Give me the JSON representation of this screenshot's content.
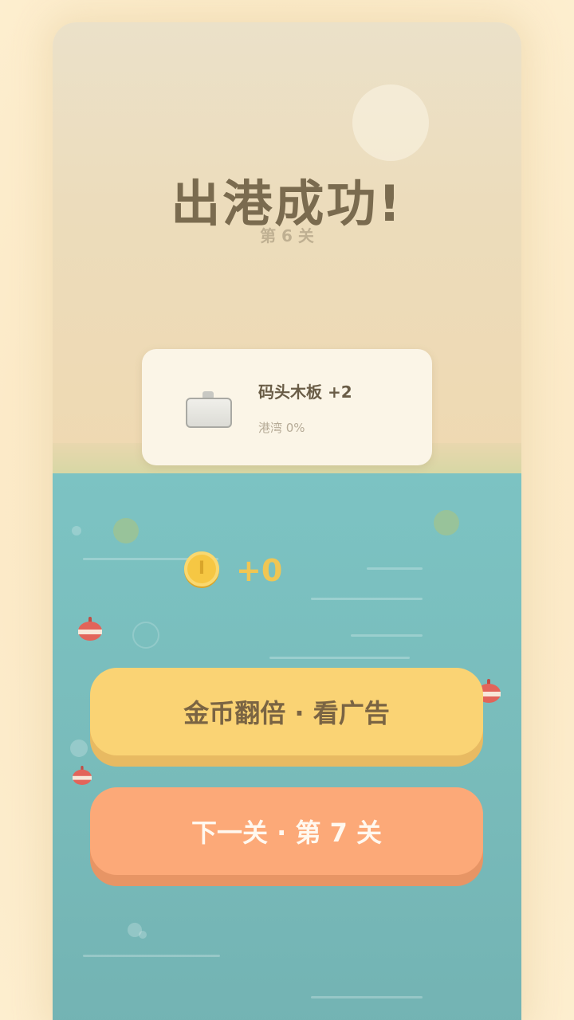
{
  "result": {
    "title": "出港成功!",
    "level_label": "第 6 关"
  },
  "reward": {
    "icon": "plank-icon",
    "name": "码头木板 +2",
    "progress_label": "港湾 0%",
    "progress_percent": 0
  },
  "coins": {
    "icon": "coin-icon",
    "symbol": "I",
    "amount": "+0"
  },
  "buttons": {
    "double_label": "金币翻倍 · 看广告",
    "next_label": "下一关 · 第 7 关"
  },
  "colors": {
    "title": "#7a6b4f",
    "water": "#7cc3c3",
    "double_button": "#fad374",
    "next_button": "#fca978",
    "coin": "#f6c743"
  }
}
